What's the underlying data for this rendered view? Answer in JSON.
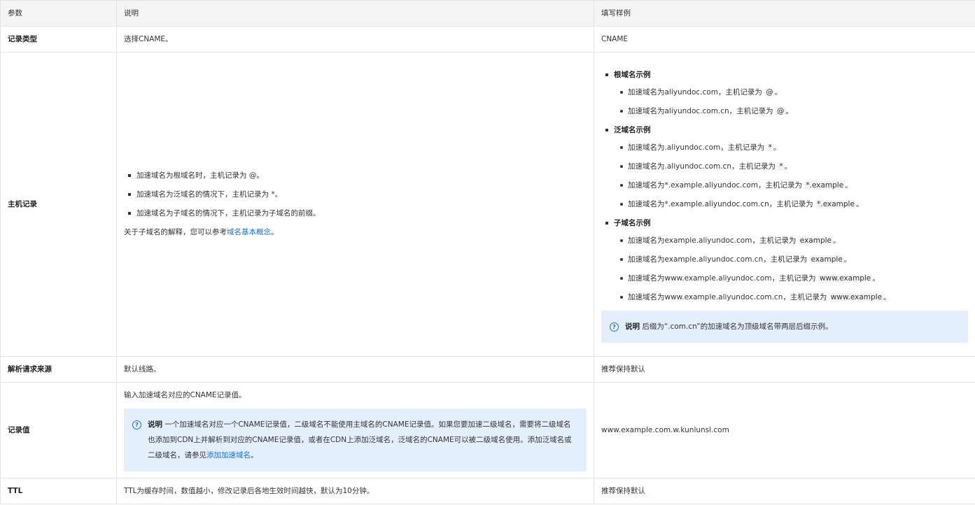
{
  "header": {
    "col1": "参数",
    "col2": "说明",
    "col3": "填写样例"
  },
  "rows": {
    "record_type": {
      "param": "记录类型",
      "desc": "选择CNAME。",
      "sample": "CNAME"
    },
    "host": {
      "param": "主机记录",
      "desc_items": [
        "加速域名为根域名时，主机记录为 @。",
        "加速域名为泛域名的情况下，主机记录为 *。",
        "加速域名为子域名的情况下，主机记录为子域名的前缀。"
      ],
      "desc_note_prefix": "关于子域名的解释，您可以参考",
      "desc_note_link": "域名基本概念",
      "desc_note_suffix": "。",
      "sample_groups": [
        {
          "title": "根域名示例",
          "items": [
            {
              "text": "加速域名为aliyundoc.com，主机记录为 ",
              "code": "@",
              "end": "。"
            },
            {
              "text": "加速域名为aliyundoc.com.cn，主机记录为 ",
              "code": "@",
              "end": "。"
            }
          ]
        },
        {
          "title": "泛域名示例",
          "items": [
            {
              "text": "加速域名为.aliyundoc.com，主机记录为 ",
              "code": "*",
              "end": "。"
            },
            {
              "text": "加速域名为.aliyundoc.com.cn，主机记录为 ",
              "code": "*",
              "end": "。"
            },
            {
              "text": "加速域名为*.example.aliyundoc.com，主机记录为 ",
              "code": "*.example",
              "end": "。"
            },
            {
              "text": "加速域名为*.example.aliyundoc.com.cn，主机记录为 ",
              "code": "*.example",
              "end": "。"
            }
          ]
        },
        {
          "title": "子域名示例",
          "items": [
            {
              "text": "加速域名为example.aliyundoc.com，主机记录为 ",
              "code": "example",
              "end": "。"
            },
            {
              "text": "加速域名为example.aliyundoc.com.cn，主机记录为 ",
              "code": "example",
              "end": "。"
            },
            {
              "text": "加速域名为www.example.aliyundoc.com，主机记录为 ",
              "code": "www.example",
              "end": "。"
            },
            {
              "text": "加速域名为www.example.aliyundoc.com.cn，主机记录为 ",
              "code": "www.example",
              "end": "。"
            }
          ]
        }
      ],
      "sample_note_label": "说明",
      "sample_note_text": " 后缀为“.com.cn”的加速域名为顶级域名带两层后缀示例。"
    },
    "source": {
      "param": "解析请求来源",
      "desc": "默认线路。",
      "sample": "推荐保持默认"
    },
    "value": {
      "param": "记录值",
      "desc": "输入加速域名对应的CNAME记录值。",
      "note_label": "说明",
      "note_text": " 一个加速域名对应一个CNAME记录值，二级域名不能使用主域名的CNAME记录值。如果您要加速二级域名，需要将二级域名也添加到CDN上并解析到对应的CNAME记录值，或者在CDN上添加泛域名，泛域名的CNAME可以被二级域名使用。添加泛域名或二级域名，请参见",
      "note_link": "添加加速域名",
      "note_end": "。",
      "sample": "www.example.com.w.kunlunsl.com"
    },
    "ttl": {
      "param": "TTL",
      "desc": "TTL为缓存时间，数值越小，修改记录后各地生效时间越快，默认为10分钟。",
      "sample": "推荐保持默认"
    }
  },
  "icons": {
    "note": "question-circle-icon"
  },
  "colors": {
    "link": "#1a6fcf",
    "note_bg": "#e3effd",
    "header_bg": "#f5f5f5",
    "border": "#e4e4e4"
  }
}
